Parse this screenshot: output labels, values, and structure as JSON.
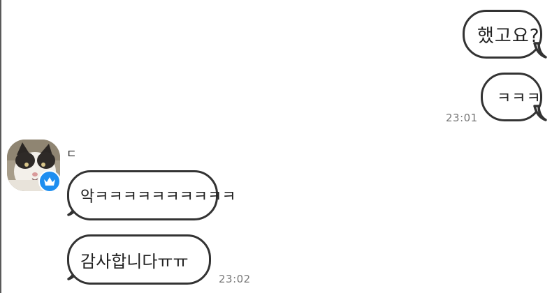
{
  "sent_messages": [
    {
      "text": "했고요?"
    },
    {
      "text": "ㅋㅋㅋ",
      "time": "23:01"
    }
  ],
  "received": {
    "sender_name": "ㄷ",
    "avatar_icon": "cat-photo",
    "badge_icon": "crown-icon",
    "badge_color": "#1e8ef0",
    "messages": [
      {
        "text": "악ㅋㅋㅋㅋㅋㅋㅋㅋㅋㅋ"
      },
      {
        "text": "감사합니다ㅠㅠ",
        "time": "23:02"
      }
    ]
  }
}
